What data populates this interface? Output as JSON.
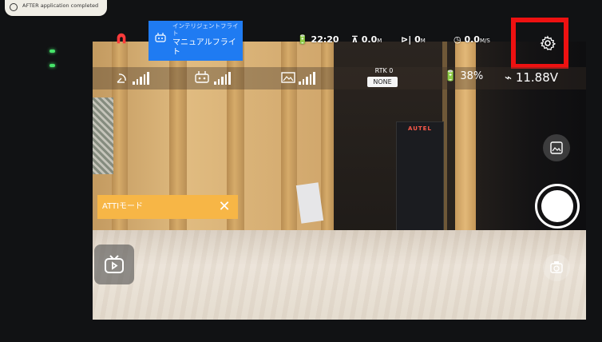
{
  "top_badge": {
    "text": "AFTER application completed"
  },
  "status_bar": {
    "mode_header": "インテリジェントフライト",
    "mode_label": "マニュアルフライト",
    "flight_time": "22:20",
    "altitude": "0.0",
    "altitude_unit": "M",
    "distance": "0",
    "distance_unit": "M",
    "speed": "0.0",
    "speed_unit": "M/S"
  },
  "signal_row": {
    "rtk_label": "RTK 0",
    "rtk_value": "NONE",
    "drone_battery": "38%",
    "voltage": "11.88V"
  },
  "warning": {
    "text": "ATTIモード",
    "close": "✕"
  },
  "camera_overlay": {
    "box_brand": "AUTEL"
  },
  "icons": [
    "signal-icon",
    "controller-icon",
    "image-transmission-icon",
    "battery-icon",
    "settings-gear-icon",
    "gallery-icon",
    "shutter-icon",
    "live-tv-icon",
    "camera-switch-icon"
  ],
  "colors": {
    "mode_blue": "#1f7bf2",
    "warning_orange": "#f7b646",
    "highlight_red": "#ee1111"
  }
}
